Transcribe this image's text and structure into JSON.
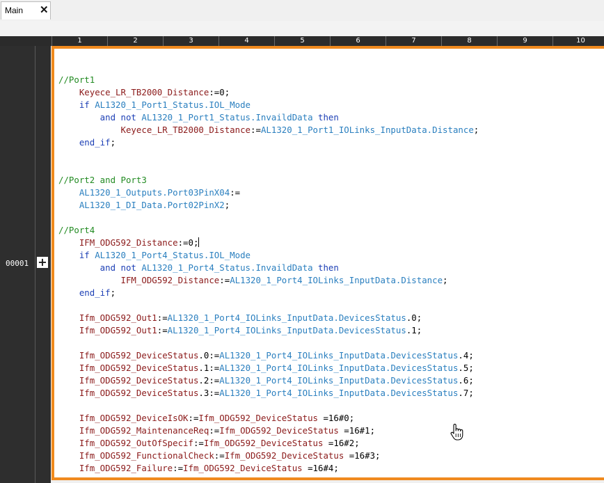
{
  "tabs": [
    {
      "label": "Main",
      "close_symbol": "✕"
    }
  ],
  "columns": [
    "1",
    "2",
    "3",
    "4",
    "5",
    "6",
    "7",
    "8",
    "9",
    "10"
  ],
  "row": {
    "number": "00001",
    "expand_symbol": "+"
  },
  "code_lines": [
    [],
    [
      [
        "//Port1",
        "comment"
      ]
    ],
    [
      [
        "    Keyece_LR_TB2000_Distance",
        "var"
      ],
      [
        ":=0;",
        "text"
      ]
    ],
    [
      [
        "    if ",
        "keyword"
      ],
      [
        "AL1320_1_Port1_Status.IOL_Mode",
        "ref"
      ]
    ],
    [
      [
        "        and not ",
        "keyword"
      ],
      [
        "AL1320_1_Port1_Status.InvaildData",
        "ref"
      ],
      [
        " then",
        "keyword"
      ]
    ],
    [
      [
        "            Keyece_LR_TB2000_Distance",
        "var"
      ],
      [
        ":=",
        "text"
      ],
      [
        "AL1320_1_Port1_IOLinks_InputData.Distance",
        "ref"
      ],
      [
        ";",
        "text"
      ]
    ],
    [
      [
        "    end_if",
        "keyword"
      ],
      [
        ";",
        "text"
      ]
    ],
    [],
    [],
    [
      [
        "//Port2 and Port3",
        "comment"
      ]
    ],
    [
      [
        "    AL1320_1_Outputs.Port03PinX04",
        "ref"
      ],
      [
        ":=",
        "text"
      ]
    ],
    [
      [
        "    AL1320_1_DI_Data.Port02PinX2",
        "ref"
      ],
      [
        ";",
        "text"
      ]
    ],
    [],
    [
      [
        "//Port4",
        "comment"
      ]
    ],
    [
      [
        "    IFM_ODG592_Distance",
        "var"
      ],
      [
        ":=0;",
        "text"
      ]
    ],
    [
      [
        "    if ",
        "keyword"
      ],
      [
        "AL1320_1_Port4_Status.IOL_Mode",
        "ref"
      ]
    ],
    [
      [
        "        and not ",
        "keyword"
      ],
      [
        "AL1320_1_Port4_Status.InvaildData",
        "ref"
      ],
      [
        " then",
        "keyword"
      ]
    ],
    [
      [
        "            IFM_ODG592_Distance",
        "var"
      ],
      [
        ":=",
        "text"
      ],
      [
        "AL1320_1_Port4_IOLinks_InputData.Distance",
        "ref"
      ],
      [
        ";",
        "text"
      ]
    ],
    [
      [
        "    end_if",
        "keyword"
      ],
      [
        ";",
        "text"
      ]
    ],
    [],
    [
      [
        "    Ifm_ODG592_Out1",
        "var"
      ],
      [
        ":=",
        "text"
      ],
      [
        "AL1320_1_Port4_IOLinks_InputData.DevicesStatus",
        "ref"
      ],
      [
        ".0;",
        "text"
      ]
    ],
    [
      [
        "    Ifm_ODG592_Out1",
        "var"
      ],
      [
        ":=",
        "text"
      ],
      [
        "AL1320_1_Port4_IOLinks_InputData.DevicesStatus",
        "ref"
      ],
      [
        ".1;",
        "text"
      ]
    ],
    [],
    [
      [
        "    Ifm_ODG592_DeviceStatus",
        "var"
      ],
      [
        ".0:=",
        "text"
      ],
      [
        "AL1320_1_Port4_IOLinks_InputData.DevicesStatus",
        "ref"
      ],
      [
        ".4;",
        "text"
      ]
    ],
    [
      [
        "    Ifm_ODG592_DeviceStatus",
        "var"
      ],
      [
        ".1:=",
        "text"
      ],
      [
        "AL1320_1_Port4_IOLinks_InputData.DevicesStatus",
        "ref"
      ],
      [
        ".5;",
        "text"
      ]
    ],
    [
      [
        "    Ifm_ODG592_DeviceStatus",
        "var"
      ],
      [
        ".2:=",
        "text"
      ],
      [
        "AL1320_1_Port4_IOLinks_InputData.DevicesStatus",
        "ref"
      ],
      [
        ".6;",
        "text"
      ]
    ],
    [
      [
        "    Ifm_ODG592_DeviceStatus",
        "var"
      ],
      [
        ".3:=",
        "text"
      ],
      [
        "AL1320_1_Port4_IOLinks_InputData.DevicesStatus",
        "ref"
      ],
      [
        ".7;",
        "text"
      ]
    ],
    [],
    [
      [
        "    Ifm_ODG592_DeviceIsOK",
        "var"
      ],
      [
        ":=",
        "text"
      ],
      [
        "Ifm_ODG592_DeviceStatus",
        "var"
      ],
      [
        " =16#0;",
        "text"
      ]
    ],
    [
      [
        "    Ifm_ODG592_MaintenanceReq",
        "var"
      ],
      [
        ":=",
        "text"
      ],
      [
        "Ifm_ODG592_DeviceStatus",
        "var"
      ],
      [
        " =16#1;",
        "text"
      ]
    ],
    [
      [
        "    Ifm_ODG592_OutOfSpecif",
        "var"
      ],
      [
        ":=",
        "text"
      ],
      [
        "Ifm_ODG592_DeviceStatus",
        "var"
      ],
      [
        " =16#2;",
        "text"
      ]
    ],
    [
      [
        "    Ifm_ODG592_FunctionalCheck",
        "var"
      ],
      [
        ":=",
        "text"
      ],
      [
        "Ifm_ODG592_DeviceStatus",
        "var"
      ],
      [
        " =16#3;",
        "text"
      ]
    ],
    [
      [
        "    Ifm_ODG592_Failure",
        "var"
      ],
      [
        ":=",
        "text"
      ],
      [
        "Ifm_ODG592_DeviceStatus",
        "var"
      ],
      [
        " =16#4;",
        "text"
      ]
    ]
  ],
  "caret_line": 14,
  "colors": {
    "comment": "#228b22",
    "keyword": "#1c3fb5",
    "var": "#8b1a1a",
    "ref": "#2a7fbf",
    "editor_border": "#f08a1e"
  },
  "icons": {
    "cursor": "hand-pointer-icon"
  }
}
